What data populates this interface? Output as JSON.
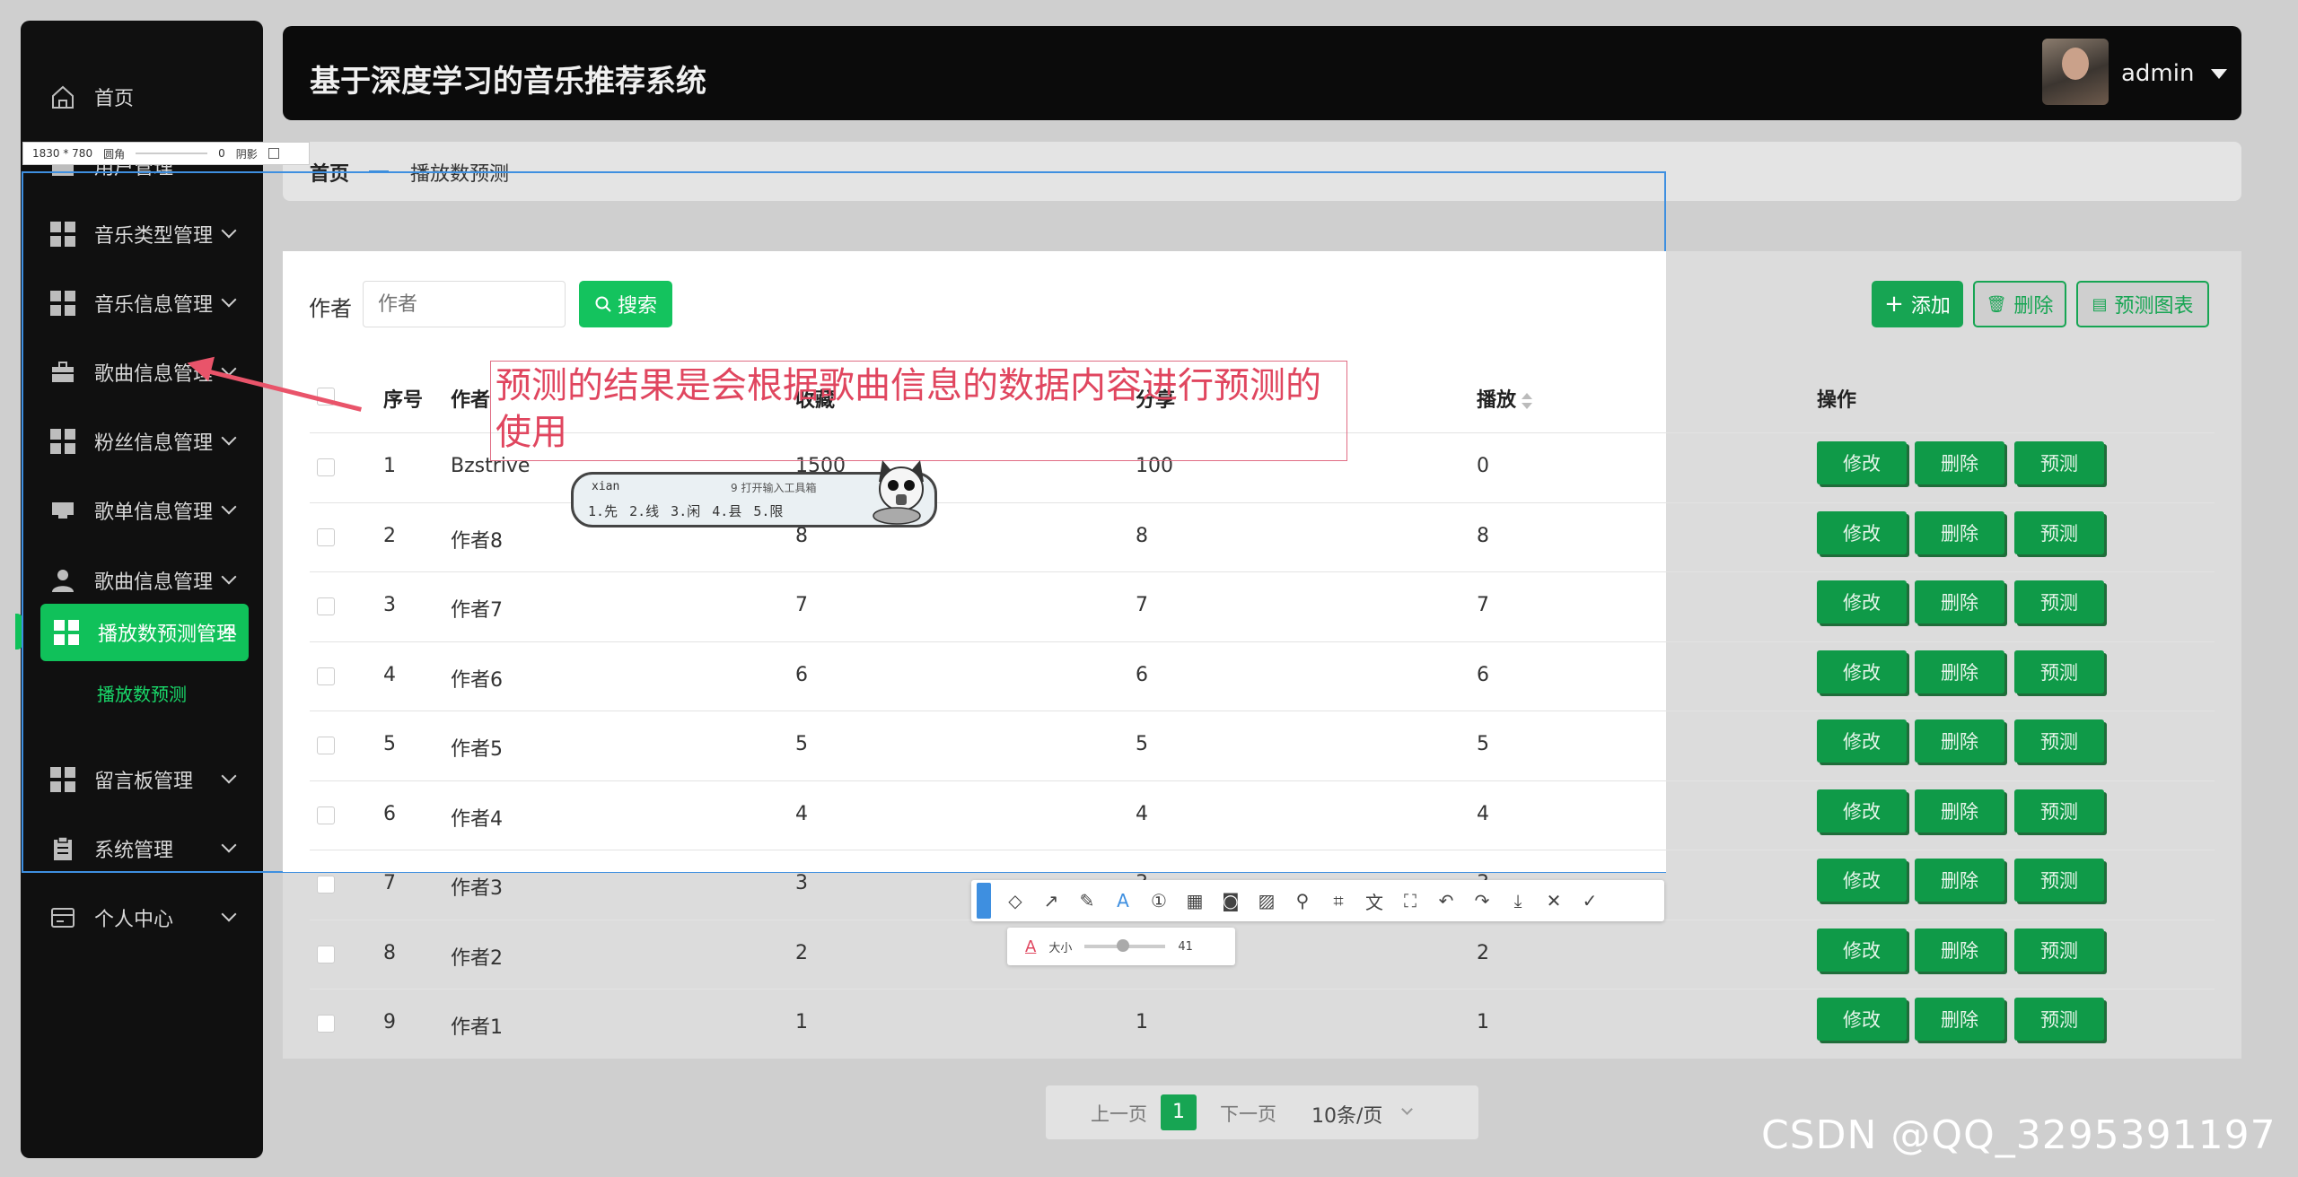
{
  "app": {
    "title": "基于深度学习的音乐推荐系统",
    "user": "admin"
  },
  "sidebar": {
    "items": [
      {
        "label": "首页"
      },
      {
        "label": "用户管理"
      },
      {
        "label": "音乐类型管理"
      },
      {
        "label": "音乐信息管理"
      },
      {
        "label": "歌曲信息管理"
      },
      {
        "label": "粉丝信息管理"
      },
      {
        "label": "歌单信息管理"
      },
      {
        "label": "歌曲信息管理"
      },
      {
        "label": "播放数预测管理"
      },
      {
        "label": "留言板管理"
      },
      {
        "label": "系统管理"
      },
      {
        "label": "个人中心"
      }
    ],
    "sub_item": "播放数预测"
  },
  "breadcrumb": {
    "home": "首页",
    "current": "播放数预测"
  },
  "search": {
    "label": "作者",
    "placeholder": "作者",
    "button": "搜索"
  },
  "actions": {
    "add": "添加",
    "delete": "删除",
    "chart": "预测图表"
  },
  "table": {
    "headers": {
      "index": "序号",
      "author": "作者",
      "collect": "收藏",
      "share": "分享",
      "play": "播放",
      "ops": "操作"
    },
    "rows": [
      {
        "index": "1",
        "author": "Bzstrive",
        "collect": "1500",
        "share": "100",
        "play": "0"
      },
      {
        "index": "2",
        "author": "作者8",
        "collect": "8",
        "share": "8",
        "play": "8"
      },
      {
        "index": "3",
        "author": "作者7",
        "collect": "7",
        "share": "7",
        "play": "7"
      },
      {
        "index": "4",
        "author": "作者6",
        "collect": "6",
        "share": "6",
        "play": "6"
      },
      {
        "index": "5",
        "author": "作者5",
        "collect": "5",
        "share": "5",
        "play": "5"
      },
      {
        "index": "6",
        "author": "作者4",
        "collect": "4",
        "share": "4",
        "play": "4"
      },
      {
        "index": "7",
        "author": "作者3",
        "collect": "3",
        "share": "3",
        "play": "3"
      },
      {
        "index": "8",
        "author": "作者2",
        "collect": "2",
        "share": "2",
        "play": "2"
      },
      {
        "index": "9",
        "author": "作者1",
        "collect": "1",
        "share": "1",
        "play": "1"
      }
    ],
    "row_buttons": {
      "edit": "修改",
      "delete": "删除",
      "predict": "预测"
    }
  },
  "annotation": {
    "text": "预测的结果是会根据歌曲信息的数据内容进行预测的使用"
  },
  "ime": {
    "input": "xian",
    "hint": "9 打开输入工具箱",
    "candidates": "1.先 2.线 3.闲 4.县 5.限"
  },
  "capture_tool": {
    "size_label": "1830 * 780",
    "radius_label": "圆角",
    "radius_value": "0",
    "shadow_label": "阴影",
    "font_size_label": "大小",
    "font_size_value": "41"
  },
  "pagination": {
    "prev": "上一页",
    "page": "1",
    "next": "下一页",
    "page_size": "10条/页"
  },
  "watermark": "CSDN @QQ_3295391197",
  "colors": {
    "accent": "#14c35e",
    "dark_green": "#0f9a48",
    "annotation": "#e0465f",
    "selection": "#3e8fe0"
  }
}
